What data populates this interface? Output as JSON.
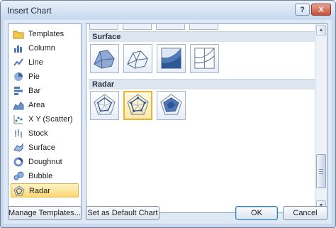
{
  "window": {
    "title": "Insert Chart",
    "help_symbol": "?",
    "close_symbol": "X"
  },
  "categories": [
    {
      "label": "Templates",
      "icon": "folder-icon"
    },
    {
      "label": "Column",
      "icon": "column-chart-icon"
    },
    {
      "label": "Line",
      "icon": "line-chart-icon"
    },
    {
      "label": "Pie",
      "icon": "pie-chart-icon"
    },
    {
      "label": "Bar",
      "icon": "bar-chart-icon"
    },
    {
      "label": "Area",
      "icon": "area-chart-icon"
    },
    {
      "label": "X Y (Scatter)",
      "icon": "scatter-chart-icon"
    },
    {
      "label": "Stock",
      "icon": "stock-chart-icon"
    },
    {
      "label": "Surface",
      "icon": "surface-chart-icon"
    },
    {
      "label": "Doughnut",
      "icon": "doughnut-chart-icon"
    },
    {
      "label": "Bubble",
      "icon": "bubble-chart-icon"
    },
    {
      "label": "Radar",
      "icon": "radar-chart-icon",
      "selected": true
    }
  ],
  "gallery": {
    "surface_header": "Surface",
    "radar_header": "Radar",
    "surface_thumbs": [
      {
        "name": "3-D Surface"
      },
      {
        "name": "Wireframe 3-D Surface"
      },
      {
        "name": "Contour"
      },
      {
        "name": "Wireframe Contour"
      }
    ],
    "radar_thumbs": [
      {
        "name": "Radar"
      },
      {
        "name": "Radar with Markers",
        "selected": true
      },
      {
        "name": "Filled Radar"
      }
    ]
  },
  "buttons": {
    "manage_templates": "Manage Templates...",
    "set_default": "Set as Default Chart",
    "ok": "OK",
    "cancel": "Cancel"
  },
  "colors": {
    "selection_fill": "#fcd872",
    "selection_border": "#e2b34a",
    "chart_blue": "#4f78b6",
    "title_bar": "#c8d9ef"
  }
}
